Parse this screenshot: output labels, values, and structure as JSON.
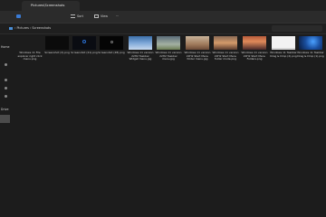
{
  "window": {
    "tab_title": "Pictures\\Screenshots"
  },
  "toolbar": {
    "sort_label": "Sort",
    "view_label": "View"
  },
  "address": {
    "segments": [
      "Pictures",
      "Screenshots"
    ],
    "separator": "›"
  },
  "sidebar": {
    "home_label": "Home",
    "drive_label": "Drive"
  },
  "files": [
    {
      "name": "Windows 11 File explorer right click menu.png"
    },
    {
      "name": "Screenshot (2).png"
    },
    {
      "name": "Screenshot (21).png"
    },
    {
      "name": "Screenshot (28).png"
    },
    {
      "name": "Windows 11 version 22H2 Taskbar Widget menu.jpg"
    },
    {
      "name": "Windows 11 version 22H2 Taskbar menu.jpg"
    },
    {
      "name": "Windows 11 version 22H2 Start Menu folder menu.jpg"
    },
    {
      "name": "Windows 11 version 22H2 Start Menu folder mode.png"
    },
    {
      "name": "Windows 11 version 22H2 Start Menu Folders.png"
    },
    {
      "name": "Windows 11 Taskbar Drag & Drop (2).png"
    },
    {
      "name": "Windows 11 Taskbar Drag & Drop (1).png"
    }
  ],
  "colors": {
    "background": "#1c1c1c",
    "toolbar": "#2b2b2b"
  }
}
